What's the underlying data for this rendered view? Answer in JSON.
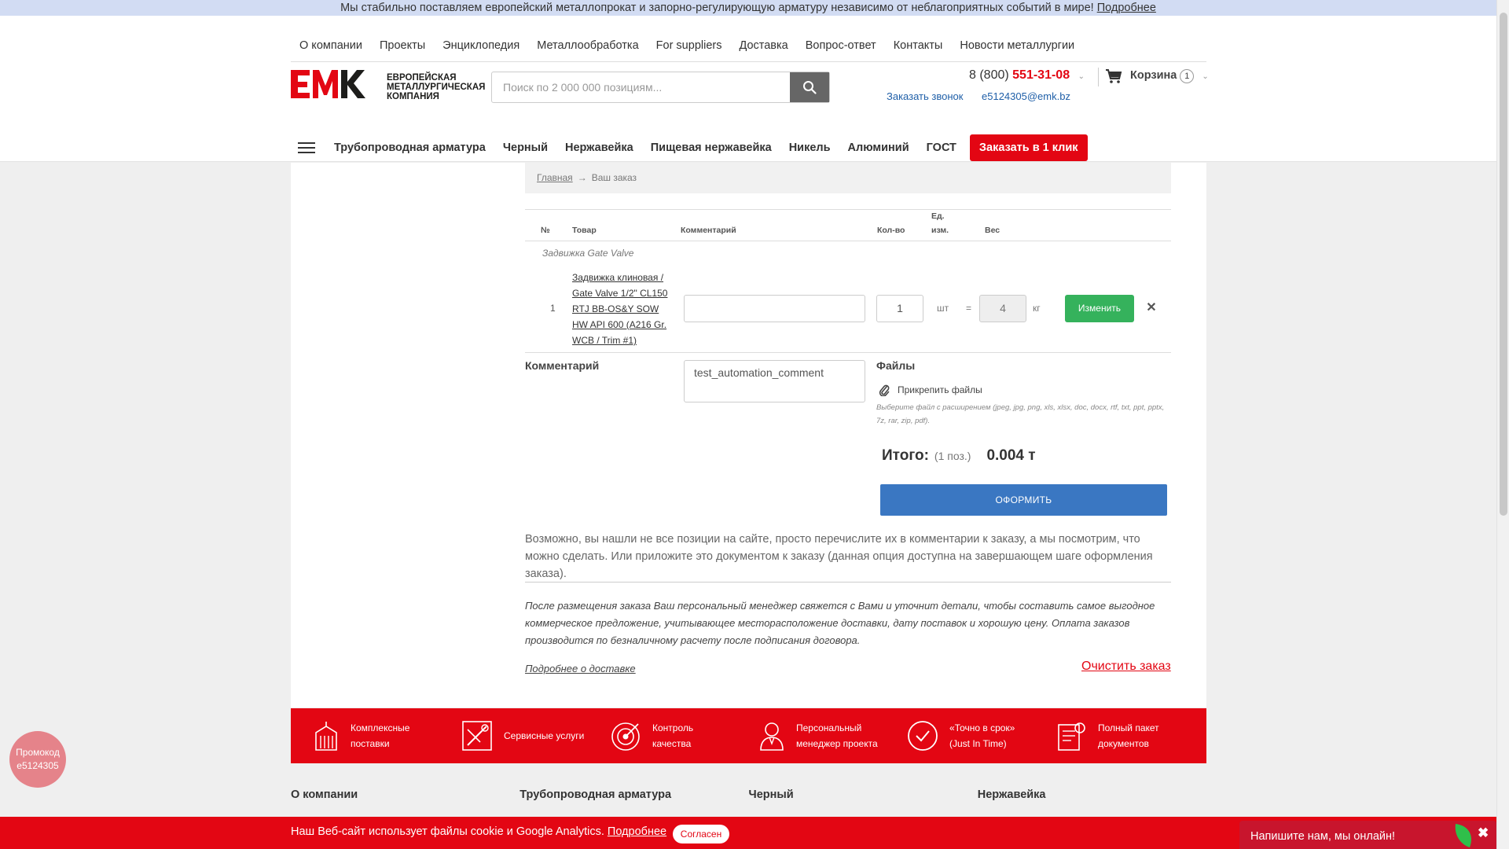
{
  "announcement": {
    "text": "Мы стабильно поставляем европейский металлопрокат и запорно-регулирующую арматуру независимо от неблагоприятных событий в мире!",
    "link": "Подробнее"
  },
  "top_nav": [
    "О компании",
    "Проекты",
    "Энциклопедия",
    "Металлообработка",
    "For suppliers",
    "Доставка",
    "Вопрос-ответ",
    "Контакты",
    "Новости металлургии"
  ],
  "logo": {
    "mark": "EMK",
    "line1": "Европейская",
    "line2": "металлургическая",
    "line3": "компания"
  },
  "search": {
    "placeholder": "Поиск по 2 000 000 позициям..."
  },
  "contacts": {
    "phone_prefix": "8 (800)",
    "phone_number": "551-31-08",
    "callback": "Заказать звонок",
    "email": "e5124305@emk.bz"
  },
  "cart": {
    "label": "Корзина",
    "count": "1"
  },
  "category_nav": [
    "Трубопроводная арматура",
    "Черный",
    "Нержавейка",
    "Пищевая нержавейка",
    "Никель",
    "Алюминий",
    "ГОСТ"
  ],
  "order_button": "Заказать в 1 клик",
  "breadcrumb": {
    "home": "Главная",
    "arrow": "→",
    "current": "Ваш заказ"
  },
  "table": {
    "headers": {
      "num": "№",
      "product": "Товар",
      "comment": "Комментарий",
      "qty": "Кол-во",
      "unit": "Ед. изм.",
      "weight": "Вес"
    },
    "group_title": "Задвижка Gate Valve",
    "row": {
      "num": "1",
      "product": "Задвижка клиновая / Gate Valve 1/2\" CL150 RTJ BB-OS&Y SOW HW API 600 (A216 Gr. WCB / Trim #1)",
      "comment_value": "",
      "qty": "1",
      "unit": "шт",
      "eq": "=",
      "weight": "4",
      "weight_unit": "кг",
      "change_button": "Изменить",
      "remove_icon": "close-icon"
    }
  },
  "order_comment": {
    "label": "Комментарий",
    "value": "test_automation_comment"
  },
  "files": {
    "label": "Файлы",
    "attach": "Прикрепить файлы",
    "hint": "Выберите файл с расширением (jpeg, jpg, png, xls, xlsx, doc, docx, rtf, txt, ppt, pptx, 7z, rar, zip, pdf)."
  },
  "total": {
    "label": "Итого:",
    "positions": "(1 поз.)",
    "value": "0.004 т"
  },
  "checkout_button": "ОФОРМИТЬ",
  "note1": "Возможно, вы нашли не все позиции на сайте, просто перечислите их в комментарии к заказу, а мы посмотрим, что можно сделать. Или приложите это документом к заказу (данная опция доступна на завершающем шаге оформления заказа).",
  "note2": "После размещения заказа Ваш персональный менеджер свяжется с Вами и уточнит детали, чтобы составить самое выгодное коммерческое предложение, учитывающее месторасположение доставки, дату поставок и хорошую цену. Оплата заказов производится по безналичному расчету после подписания договора.",
  "delivery_link": "Подробнее о доставке",
  "clear_link": "Очистить заказ",
  "benefits": [
    {
      "icon": "warehouse-icon",
      "line1": "Комплексные",
      "line2": "поставки"
    },
    {
      "icon": "tools-icon",
      "line1": "Сервисные услуги",
      "line2": ""
    },
    {
      "icon": "target-icon",
      "line1": "Контроль",
      "line2": "качества"
    },
    {
      "icon": "manager-icon",
      "line1": "Персональный",
      "line2": "менеджер проекта"
    },
    {
      "icon": "clock-icon",
      "line1": "«Точно в срок»",
      "line2": "(Just In Time)"
    },
    {
      "icon": "documents-icon",
      "line1": "Полный пакет",
      "line2": "документов"
    }
  ],
  "footer_cols": [
    "О компании",
    "Трубопроводная арматура",
    "Черный",
    "Нержавейка"
  ],
  "promo": {
    "line1": "Промокод",
    "line2": "e5124305"
  },
  "cookie": {
    "text": "Наш Веб-сайт использует файлы cookie и Google Analytics.",
    "link": "Подробнее",
    "button": "Согласен"
  },
  "chat": {
    "text": "Напишите нам, мы онлайн!"
  },
  "colors": {
    "brand_red": "#e30613",
    "link_blue": "#1f5fa8",
    "checkout_blue": "#3a77c2",
    "change_green": "#35b25c"
  }
}
